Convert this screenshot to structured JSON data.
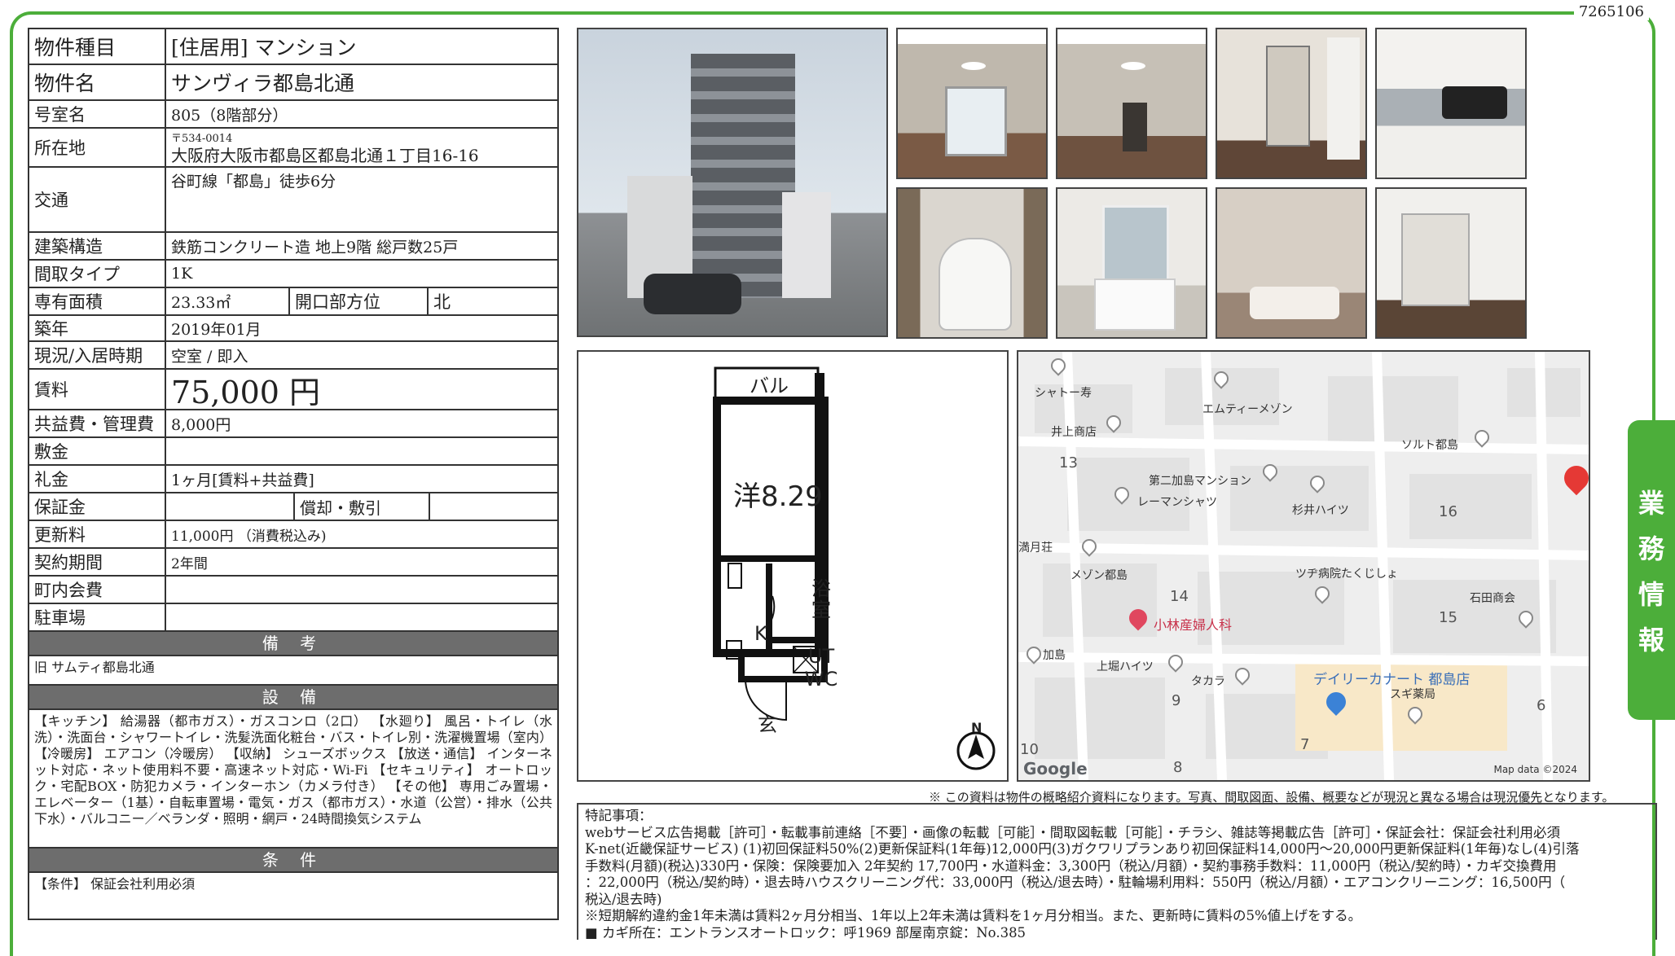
{
  "doc_id": "7265106",
  "side_tab": [
    "業",
    "務",
    "情",
    "報"
  ],
  "property": {
    "type_label": "物件種目",
    "type_value": "[住居用]  マンション",
    "name_label": "物件名",
    "name_value": "サンヴィラ都島北通",
    "room_label": "号室名",
    "room_value": "805（8階部分）",
    "address_label": "所在地",
    "postal": "〒534-0014",
    "address_value": "大阪府大阪市都島区都島北通１丁目16-16",
    "transport_label": "交通",
    "transport_value": "谷町線「都島」徒歩6分",
    "structure_label": "建築構造",
    "structure_value": "鉄筋コンクリート造  地上9階  総戸数25戸",
    "layout_label": "間取タイプ",
    "layout_value": "1K",
    "area_label": "専有面積",
    "area_value": "23.33㎡",
    "opening_label": "開口部方位",
    "opening_value": "北",
    "built_label": "築年",
    "built_value": "2019年01月",
    "status_label": "現況/入居時期",
    "status_value": "空室  /  即入",
    "rent_label": "賃料",
    "rent_value": "75,000 円",
    "fee_label": "共益費・管理費",
    "fee_value": "8,000円",
    "deposit_label": "敷金",
    "deposit_value": "",
    "key_money_label": "礼金",
    "key_money_value": "1ヶ月[賃料+共益費]",
    "guarantee_label": "保証金",
    "guarantee_value": "",
    "amort_label": "償却・敷引",
    "amort_value": "",
    "renewal_label": "更新料",
    "renewal_value": "11,000円  （消費税込み)",
    "contract_label": "契約期間",
    "contract_value": "2年間",
    "town_fee_label": "町内会費",
    "town_fee_value": "",
    "parking_label": "駐車場",
    "parking_value": ""
  },
  "remarks": {
    "header": "備 考",
    "text": "旧 サムティ都島北通"
  },
  "facilities": {
    "header": "設 備",
    "text": "【キッチン】 給湯器（都市ガス）・ガスコンロ（2口）  【水廻り】 風呂・トイレ（水洗）・洗面台・シャワートイレ・洗髪洗面化粧台・バス・トイレ別・洗濯機置場（室内）  【冷暖房】 エアコン（冷暖房）  【収納】 シューズボックス  【放送・通信】 インターネット対応・ネット使用料不要・高速ネット対応・Wi-Fi  【セキュリティ】 オートロック・宅配BOX・防犯カメラ・インターホン（カメラ付き）  【その他】 専用ごみ置場・エレベーター（1基）・自転車置場・電気・ガス（都市ガス）・水道（公営）・排水（公共下水）・バルコニー／ベランダ・照明・網戸・24時間換気システム"
  },
  "conditions": {
    "header": "条 件",
    "text": "【条件】 保証会社利用必須"
  },
  "floorplan": {
    "balcony": "バル",
    "room": "洋8.29",
    "bath": [
      "浴",
      "室"
    ],
    "kitchen": "K",
    "utwc": [
      "UT",
      "WC"
    ],
    "entrance": "玄",
    "north": "N"
  },
  "map": {
    "labels": [
      "シャトー寿",
      "エムティーメゾン",
      "井上商店",
      "ソルト都島",
      "第二加島マンション",
      "レーマンシャツ",
      "杉井ハイツ",
      "満月荘",
      "メゾン都島",
      "ツヂ病院たくじしょ",
      "石田商会",
      "小林産婦人科",
      "加島",
      "上堀ハイツ",
      "タカラ",
      "デイリーカナート 都島店",
      "スギ薬局"
    ],
    "numbers": [
      "13",
      "16",
      "14",
      "15",
      "9",
      "6",
      "7",
      "10",
      "8"
    ],
    "logo": "Google",
    "copyright": "Map data ©2024"
  },
  "note": "※ この資料は物件の概略紹介資料になります。写真、間取図面、設備、概要などが現況と異なる場合は現況優先となります。",
  "special": {
    "title": "特記事項：",
    "lines": [
      "webサービス広告掲載［許可］・転載事前連絡［不要］・画像の転載［可能］・間取図転載［可能］・チラシ、雑誌等掲載広告［許可］・保証会社：保証会社利用必須",
      "K-net(近畿保証サービス) (1)初回保証料50%(2)更新保証料(1年毎)12,000円(3)ガクワリプランあり初回保証料14,000円〜20,000円更新保証料(1年毎)なし(4)引落",
      "手数料(月額)(税込)330円・保険：保険要加入 2年契約 17,700円・水道料金：3,300円（税込/月額）・契約事務手数料：11,000円（税込/契約時）・カギ交換費用",
      "：22,000円（税込/契約時）・退去時ハウスクリーニング代：33,000円（税込/退去時）・駐輪場利用料：550円（税込/月額）・エアコンクリーニング：16,500円（",
      "税込/退去時)",
      "※短期解約違約金1年未満は賃料2ヶ月分相当、1年以上2年未満は賃料を1ヶ月分相当。また、更新時に賃料の5%値上げをする。",
      "■ カギ所在：エントランスオートロック：呼1969  部屋南京錠：No.385"
    ]
  }
}
